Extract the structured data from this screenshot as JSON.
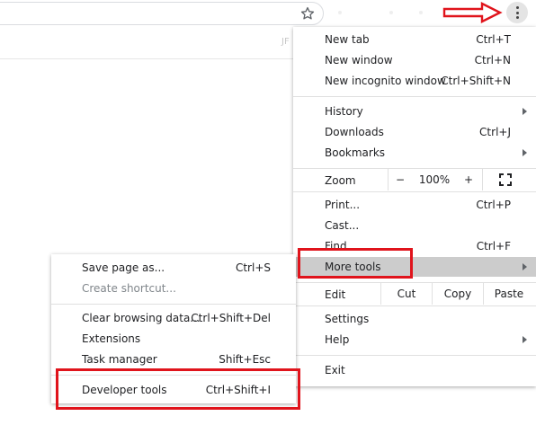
{
  "toolbar": {
    "bookmark_icon": "star-icon",
    "menu_icon": "three-dots-vertical-icon",
    "ghost_text": "JF"
  },
  "main_menu": {
    "group1": [
      {
        "label": "New tab",
        "shortcut": "Ctrl+T"
      },
      {
        "label": "New window",
        "shortcut": "Ctrl+N"
      },
      {
        "label": "New incognito window",
        "shortcut": "Ctrl+Shift+N"
      }
    ],
    "group2": [
      {
        "label": "History",
        "shortcut": ""
      },
      {
        "label": "Downloads",
        "shortcut": "Ctrl+J"
      },
      {
        "label": "Bookmarks",
        "shortcut": ""
      }
    ],
    "zoom": {
      "label": "Zoom",
      "minus": "−",
      "value": "100%",
      "plus": "+",
      "fullscreen_icon": "fullscreen-icon"
    },
    "group3": [
      {
        "label": "Print...",
        "shortcut": "Ctrl+P"
      },
      {
        "label": "Cast...",
        "shortcut": ""
      },
      {
        "label": "Find...",
        "shortcut": "Ctrl+F"
      },
      {
        "label": "More tools",
        "shortcut": ""
      }
    ],
    "edit": {
      "label": "Edit",
      "cut": "Cut",
      "copy": "Copy",
      "paste": "Paste"
    },
    "group4": [
      {
        "label": "Settings",
        "shortcut": ""
      },
      {
        "label": "Help",
        "shortcut": ""
      }
    ],
    "exit": {
      "label": "Exit"
    }
  },
  "sub_menu": {
    "group1": [
      {
        "label": "Save page as...",
        "shortcut": "Ctrl+S"
      },
      {
        "label": "Create shortcut...",
        "shortcut": ""
      }
    ],
    "group2": [
      {
        "label": "Clear browsing data...",
        "shortcut": "Ctrl+Shift+Del"
      },
      {
        "label": "Extensions",
        "shortcut": ""
      },
      {
        "label": "Task manager",
        "shortcut": "Shift+Esc"
      }
    ],
    "group3": [
      {
        "label": "Developer tools",
        "shortcut": "Ctrl+Shift+I"
      }
    ]
  },
  "colors": {
    "annotation_red": "#e0141c",
    "highlight": "#cccccc"
  }
}
